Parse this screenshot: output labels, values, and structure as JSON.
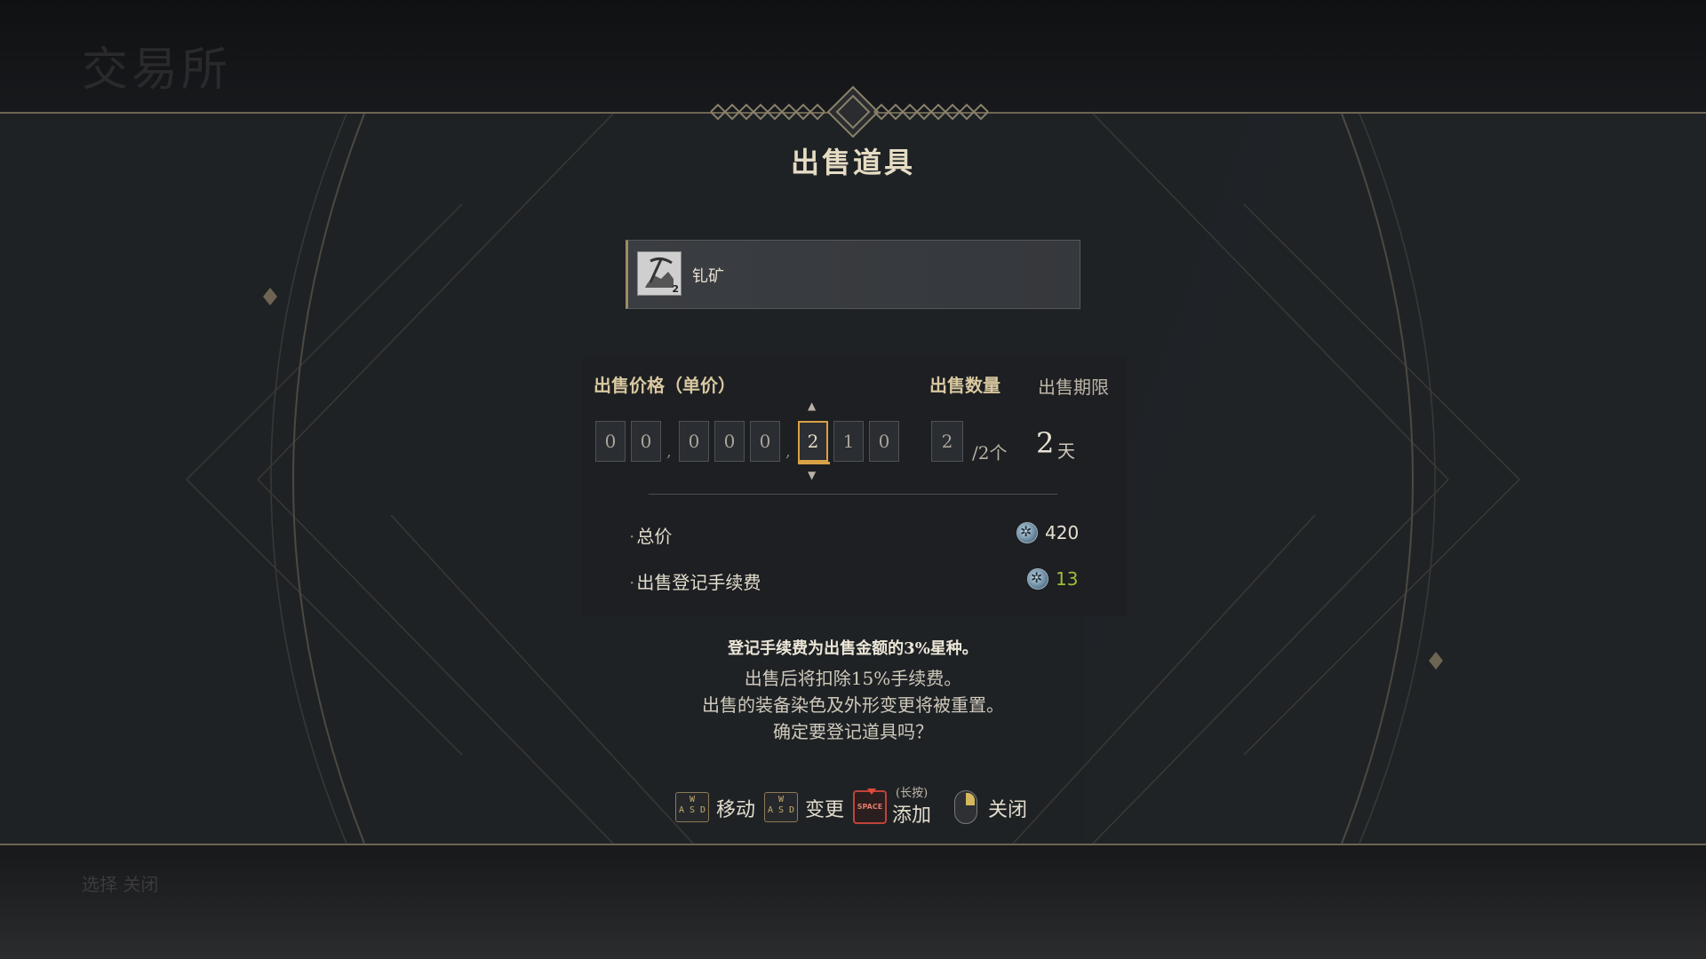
{
  "background": {
    "title": "交易所",
    "bottom_hint": "选择   关闭"
  },
  "dialog": {
    "title": "出售道具",
    "item": {
      "name": "钆矿",
      "quantity_badge": "2",
      "icon": "ore-pickaxe-icon"
    },
    "labels": {
      "price": "出售价格（单价）",
      "quantity": "出售数量",
      "period": "出售期限"
    },
    "price_digits": [
      "0",
      "0",
      "0",
      "0",
      "0",
      "2",
      "1",
      "0"
    ],
    "price_separator": ",",
    "active_digit_index": 5,
    "quantity": "2",
    "quantity_max": "/2个",
    "period_value": "2",
    "period_unit": "天",
    "total": {
      "label": "总价",
      "value": "420"
    },
    "fee": {
      "label": "出售登记手续费",
      "value": "13"
    },
    "currency_icon": "star-seed-coin-icon",
    "notes": [
      "登记手续费为出售金额的3%星种。",
      "出售后将扣除15%手续费。",
      "出售的装备染色及外形变更将被重置。",
      "确定要登记道具吗？"
    ],
    "hints": {
      "move": "移动",
      "change": "变更",
      "add_longpress": "(长按)",
      "add": "添加",
      "close": "关闭",
      "key_wasd": "W\nA S D",
      "key_space": "SPACE"
    },
    "colors": {
      "accent_gold": "#d9a244",
      "fee_green": "#9fbf3a",
      "space_red": "#c0433a"
    }
  }
}
